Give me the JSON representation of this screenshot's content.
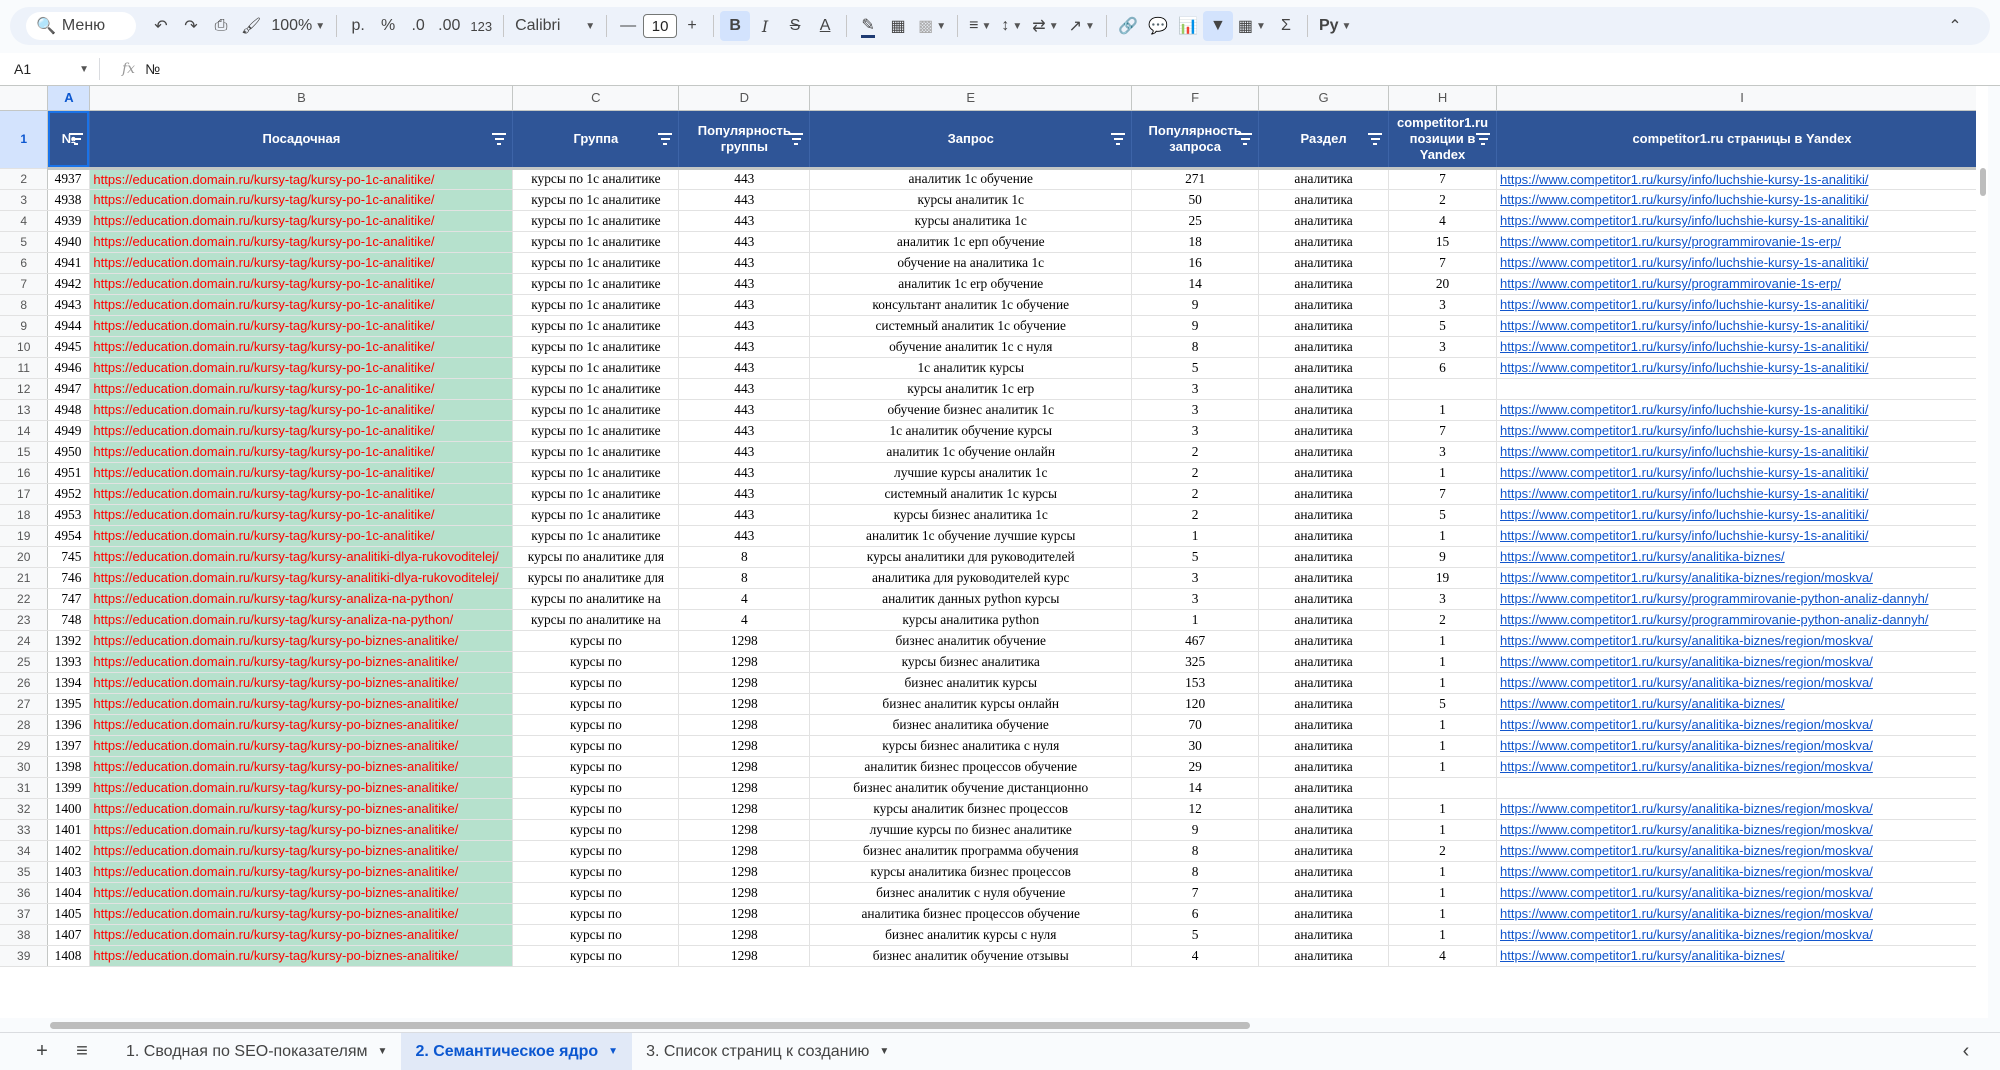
{
  "toolbar": {
    "menu_label": "Меню",
    "zoom": "100%",
    "currency": "р.",
    "percent": "%",
    "dec_decrease": ".0",
    "dec_increase": ".00",
    "number_format": "123",
    "font": "Calibri",
    "font_size": "10",
    "bold": "B",
    "italic": "I",
    "strike": "S",
    "text_color": "A",
    "sum": "Σ",
    "script": "Py"
  },
  "formula_bar": {
    "cell_ref": "A1",
    "fx": "fx",
    "content": "№"
  },
  "columns": [
    "A",
    "B",
    "C",
    "D",
    "E",
    "F",
    "G",
    "H",
    "I"
  ],
  "header_row": {
    "row_number": "1",
    "cells": [
      "№",
      "Посадочная",
      "Группа",
      "Популярность группы",
      "Запрос",
      "Популярность запроса",
      "Раздел",
      "competitor1.ru позиции в Yandex",
      "competitor1.ru страницы в Yandex"
    ]
  },
  "rows": [
    {
      "n": "2",
      "a": "4937",
      "b": "https://education.domain.ru/kursy-tag/kursy-po-1c-analitike/",
      "c": "курсы по 1с аналитике",
      "d": "443",
      "e": "аналитик 1с обучение",
      "f": "271",
      "g": "аналитика",
      "h": "7",
      "i": "https://www.competitor1.ru/kursy/info/luchshie-kursy-1s-analitiki/"
    },
    {
      "n": "3",
      "a": "4938",
      "b": "https://education.domain.ru/kursy-tag/kursy-po-1c-analitike/",
      "c": "курсы по 1с аналитике",
      "d": "443",
      "e": "курсы аналитик 1с",
      "f": "50",
      "g": "аналитика",
      "h": "2",
      "i": "https://www.competitor1.ru/kursy/info/luchshie-kursy-1s-analitiki/"
    },
    {
      "n": "4",
      "a": "4939",
      "b": "https://education.domain.ru/kursy-tag/kursy-po-1c-analitike/",
      "c": "курсы по 1с аналитике",
      "d": "443",
      "e": "курсы аналитика 1с",
      "f": "25",
      "g": "аналитика",
      "h": "4",
      "i": "https://www.competitor1.ru/kursy/info/luchshie-kursy-1s-analitiki/"
    },
    {
      "n": "5",
      "a": "4940",
      "b": "https://education.domain.ru/kursy-tag/kursy-po-1c-analitike/",
      "c": "курсы по 1с аналитике",
      "d": "443",
      "e": "аналитик 1с ерп обучение",
      "f": "18",
      "g": "аналитика",
      "h": "15",
      "i": "https://www.competitor1.ru/kursy/programmirovanie-1s-erp/"
    },
    {
      "n": "6",
      "a": "4941",
      "b": "https://education.domain.ru/kursy-tag/kursy-po-1c-analitike/",
      "c": "курсы по 1с аналитике",
      "d": "443",
      "e": "обучение на аналитика 1с",
      "f": "16",
      "g": "аналитика",
      "h": "7",
      "i": "https://www.competitor1.ru/kursy/info/luchshie-kursy-1s-analitiki/"
    },
    {
      "n": "7",
      "a": "4942",
      "b": "https://education.domain.ru/kursy-tag/kursy-po-1c-analitike/",
      "c": "курсы по 1с аналитике",
      "d": "443",
      "e": "аналитик 1с erp обучение",
      "f": "14",
      "g": "аналитика",
      "h": "20",
      "i": "https://www.competitor1.ru/kursy/programmirovanie-1s-erp/"
    },
    {
      "n": "8",
      "a": "4943",
      "b": "https://education.domain.ru/kursy-tag/kursy-po-1c-analitike/",
      "c": "курсы по 1с аналитике",
      "d": "443",
      "e": "консультант аналитик 1с обучение",
      "f": "9",
      "g": "аналитика",
      "h": "3",
      "i": "https://www.competitor1.ru/kursy/info/luchshie-kursy-1s-analitiki/"
    },
    {
      "n": "9",
      "a": "4944",
      "b": "https://education.domain.ru/kursy-tag/kursy-po-1c-analitike/",
      "c": "курсы по 1с аналитике",
      "d": "443",
      "e": "системный аналитик 1с обучение",
      "f": "9",
      "g": "аналитика",
      "h": "5",
      "i": "https://www.competitor1.ru/kursy/info/luchshie-kursy-1s-analitiki/"
    },
    {
      "n": "10",
      "a": "4945",
      "b": "https://education.domain.ru/kursy-tag/kursy-po-1c-analitike/",
      "c": "курсы по 1с аналитике",
      "d": "443",
      "e": "обучение аналитик 1с с нуля",
      "f": "8",
      "g": "аналитика",
      "h": "3",
      "i": "https://www.competitor1.ru/kursy/info/luchshie-kursy-1s-analitiki/"
    },
    {
      "n": "11",
      "a": "4946",
      "b": "https://education.domain.ru/kursy-tag/kursy-po-1c-analitike/",
      "c": "курсы по 1с аналитике",
      "d": "443",
      "e": "1с аналитик курсы",
      "f": "5",
      "g": "аналитика",
      "h": "6",
      "i": "https://www.competitor1.ru/kursy/info/luchshie-kursy-1s-analitiki/"
    },
    {
      "n": "12",
      "a": "4947",
      "b": "https://education.domain.ru/kursy-tag/kursy-po-1c-analitike/",
      "c": "курсы по 1с аналитике",
      "d": "443",
      "e": "курсы аналитик 1с erp",
      "f": "3",
      "g": "аналитика",
      "h": "",
      "i": ""
    },
    {
      "n": "13",
      "a": "4948",
      "b": "https://education.domain.ru/kursy-tag/kursy-po-1c-analitike/",
      "c": "курсы по 1с аналитике",
      "d": "443",
      "e": "обучение бизнес аналитик 1с",
      "f": "3",
      "g": "аналитика",
      "h": "1",
      "i": "https://www.competitor1.ru/kursy/info/luchshie-kursy-1s-analitiki/"
    },
    {
      "n": "14",
      "a": "4949",
      "b": "https://education.domain.ru/kursy-tag/kursy-po-1c-analitike/",
      "c": "курсы по 1с аналитике",
      "d": "443",
      "e": "1с аналитик обучение курсы",
      "f": "3",
      "g": "аналитика",
      "h": "7",
      "i": "https://www.competitor1.ru/kursy/info/luchshie-kursy-1s-analitiki/"
    },
    {
      "n": "15",
      "a": "4950",
      "b": "https://education.domain.ru/kursy-tag/kursy-po-1c-analitike/",
      "c": "курсы по 1с аналитике",
      "d": "443",
      "e": "аналитик 1с обучение онлайн",
      "f": "2",
      "g": "аналитика",
      "h": "3",
      "i": "https://www.competitor1.ru/kursy/info/luchshie-kursy-1s-analitiki/"
    },
    {
      "n": "16",
      "a": "4951",
      "b": "https://education.domain.ru/kursy-tag/kursy-po-1c-analitike/",
      "c": "курсы по 1с аналитике",
      "d": "443",
      "e": "лучшие курсы аналитик 1с",
      "f": "2",
      "g": "аналитика",
      "h": "1",
      "i": "https://www.competitor1.ru/kursy/info/luchshie-kursy-1s-analitiki/"
    },
    {
      "n": "17",
      "a": "4952",
      "b": "https://education.domain.ru/kursy-tag/kursy-po-1c-analitike/",
      "c": "курсы по 1с аналитике",
      "d": "443",
      "e": "системный аналитик 1с курсы",
      "f": "2",
      "g": "аналитика",
      "h": "7",
      "i": "https://www.competitor1.ru/kursy/info/luchshie-kursy-1s-analitiki/"
    },
    {
      "n": "18",
      "a": "4953",
      "b": "https://education.domain.ru/kursy-tag/kursy-po-1c-analitike/",
      "c": "курсы по 1с аналитике",
      "d": "443",
      "e": "курсы бизнес аналитика 1с",
      "f": "2",
      "g": "аналитика",
      "h": "5",
      "i": "https://www.competitor1.ru/kursy/info/luchshie-kursy-1s-analitiki/"
    },
    {
      "n": "19",
      "a": "4954",
      "b": "https://education.domain.ru/kursy-tag/kursy-po-1c-analitike/",
      "c": "курсы по 1с аналитике",
      "d": "443",
      "e": "аналитик 1с обучение лучшие курсы",
      "f": "1",
      "g": "аналитика",
      "h": "1",
      "i": "https://www.competitor1.ru/kursy/info/luchshie-kursy-1s-analitiki/"
    },
    {
      "n": "20",
      "a": "745",
      "b": "https://education.domain.ru/kursy-tag/kursy-analitiki-dlya-rukovoditelej/",
      "c": "курсы по аналитике для",
      "d": "8",
      "e": "курсы аналитики для руководителей",
      "f": "5",
      "g": "аналитика",
      "h": "9",
      "i": "https://www.competitor1.ru/kursy/analitika-biznes/"
    },
    {
      "n": "21",
      "a": "746",
      "b": "https://education.domain.ru/kursy-tag/kursy-analitiki-dlya-rukovoditelej/",
      "c": "курсы по аналитике для",
      "d": "8",
      "e": "аналитика для руководителей курс",
      "f": "3",
      "g": "аналитика",
      "h": "19",
      "i": "https://www.competitor1.ru/kursy/analitika-biznes/region/moskva/"
    },
    {
      "n": "22",
      "a": "747",
      "b": "https://education.domain.ru/kursy-tag/kursy-analiza-na-python/",
      "c": "курсы по аналитике на",
      "d": "4",
      "e": "аналитик данных python курсы",
      "f": "3",
      "g": "аналитика",
      "h": "3",
      "i": "https://www.competitor1.ru/kursy/programmirovanie-python-analiz-dannyh/"
    },
    {
      "n": "23",
      "a": "748",
      "b": "https://education.domain.ru/kursy-tag/kursy-analiza-na-python/",
      "c": "курсы по аналитике на",
      "d": "4",
      "e": "курсы аналитика python",
      "f": "1",
      "g": "аналитика",
      "h": "2",
      "i": "https://www.competitor1.ru/kursy/programmirovanie-python-analiz-dannyh/"
    },
    {
      "n": "24",
      "a": "1392",
      "b": "https://education.domain.ru/kursy-tag/kursy-po-biznes-analitike/",
      "c": "курсы по",
      "d": "1298",
      "e": "бизнес аналитик обучение",
      "f": "467",
      "g": "аналитика",
      "h": "1",
      "i": "https://www.competitor1.ru/kursy/analitika-biznes/region/moskva/"
    },
    {
      "n": "25",
      "a": "1393",
      "b": "https://education.domain.ru/kursy-tag/kursy-po-biznes-analitike/",
      "c": "курсы по",
      "d": "1298",
      "e": "курсы бизнес аналитика",
      "f": "325",
      "g": "аналитика",
      "h": "1",
      "i": "https://www.competitor1.ru/kursy/analitika-biznes/region/moskva/"
    },
    {
      "n": "26",
      "a": "1394",
      "b": "https://education.domain.ru/kursy-tag/kursy-po-biznes-analitike/",
      "c": "курсы по",
      "d": "1298",
      "e": "бизнес аналитик курсы",
      "f": "153",
      "g": "аналитика",
      "h": "1",
      "i": "https://www.competitor1.ru/kursy/analitika-biznes/region/moskva/"
    },
    {
      "n": "27",
      "a": "1395",
      "b": "https://education.domain.ru/kursy-tag/kursy-po-biznes-analitike/",
      "c": "курсы по",
      "d": "1298",
      "e": "бизнес аналитик курсы онлайн",
      "f": "120",
      "g": "аналитика",
      "h": "5",
      "i": "https://www.competitor1.ru/kursy/analitika-biznes/"
    },
    {
      "n": "28",
      "a": "1396",
      "b": "https://education.domain.ru/kursy-tag/kursy-po-biznes-analitike/",
      "c": "курсы по",
      "d": "1298",
      "e": "бизнес аналитика обучение",
      "f": "70",
      "g": "аналитика",
      "h": "1",
      "i": "https://www.competitor1.ru/kursy/analitika-biznes/region/moskva/"
    },
    {
      "n": "29",
      "a": "1397",
      "b": "https://education.domain.ru/kursy-tag/kursy-po-biznes-analitike/",
      "c": "курсы по",
      "d": "1298",
      "e": "курсы бизнес аналитика с нуля",
      "f": "30",
      "g": "аналитика",
      "h": "1",
      "i": "https://www.competitor1.ru/kursy/analitika-biznes/region/moskva/"
    },
    {
      "n": "30",
      "a": "1398",
      "b": "https://education.domain.ru/kursy-tag/kursy-po-biznes-analitike/",
      "c": "курсы по",
      "d": "1298",
      "e": "аналитик бизнес процессов обучение",
      "f": "29",
      "g": "аналитика",
      "h": "1",
      "i": "https://www.competitor1.ru/kursy/analitika-biznes/region/moskva/"
    },
    {
      "n": "31",
      "a": "1399",
      "b": "https://education.domain.ru/kursy-tag/kursy-po-biznes-analitike/",
      "c": "курсы по",
      "d": "1298",
      "e": "бизнес аналитик обучение дистанционно",
      "f": "14",
      "g": "аналитика",
      "h": "",
      "i": ""
    },
    {
      "n": "32",
      "a": "1400",
      "b": "https://education.domain.ru/kursy-tag/kursy-po-biznes-analitike/",
      "c": "курсы по",
      "d": "1298",
      "e": "курсы аналитик бизнес процессов",
      "f": "12",
      "g": "аналитика",
      "h": "1",
      "i": "https://www.competitor1.ru/kursy/analitika-biznes/region/moskva/"
    },
    {
      "n": "33",
      "a": "1401",
      "b": "https://education.domain.ru/kursy-tag/kursy-po-biznes-analitike/",
      "c": "курсы по",
      "d": "1298",
      "e": "лучшие курсы по бизнес аналитике",
      "f": "9",
      "g": "аналитика",
      "h": "1",
      "i": "https://www.competitor1.ru/kursy/analitika-biznes/region/moskva/"
    },
    {
      "n": "34",
      "a": "1402",
      "b": "https://education.domain.ru/kursy-tag/kursy-po-biznes-analitike/",
      "c": "курсы по",
      "d": "1298",
      "e": "бизнес аналитик программа обучения",
      "f": "8",
      "g": "аналитика",
      "h": "2",
      "i": "https://www.competitor1.ru/kursy/analitika-biznes/region/moskva/"
    },
    {
      "n": "35",
      "a": "1403",
      "b": "https://education.domain.ru/kursy-tag/kursy-po-biznes-analitike/",
      "c": "курсы по",
      "d": "1298",
      "e": "курсы аналитика бизнес процессов",
      "f": "8",
      "g": "аналитика",
      "h": "1",
      "i": "https://www.competitor1.ru/kursy/analitika-biznes/region/moskva/"
    },
    {
      "n": "36",
      "a": "1404",
      "b": "https://education.domain.ru/kursy-tag/kursy-po-biznes-analitike/",
      "c": "курсы по",
      "d": "1298",
      "e": "бизнес аналитик с нуля обучение",
      "f": "7",
      "g": "аналитика",
      "h": "1",
      "i": "https://www.competitor1.ru/kursy/analitika-biznes/region/moskva/"
    },
    {
      "n": "37",
      "a": "1405",
      "b": "https://education.domain.ru/kursy-tag/kursy-po-biznes-analitike/",
      "c": "курсы по",
      "d": "1298",
      "e": "аналитика бизнес процессов обучение",
      "f": "6",
      "g": "аналитика",
      "h": "1",
      "i": "https://www.competitor1.ru/kursy/analitika-biznes/region/moskva/"
    },
    {
      "n": "38",
      "a": "1407",
      "b": "https://education.domain.ru/kursy-tag/kursy-po-biznes-analitike/",
      "c": "курсы по",
      "d": "1298",
      "e": "бизнес аналитик курсы с нуля",
      "f": "5",
      "g": "аналитика",
      "h": "1",
      "i": "https://www.competitor1.ru/kursy/analitika-biznes/region/moskva/"
    },
    {
      "n": "39",
      "a": "1408",
      "b": "https://education.domain.ru/kursy-tag/kursy-po-biznes-analitike/",
      "c": "курсы по",
      "d": "1298",
      "e": "бизнес аналитик обучение отзывы",
      "f": "4",
      "g": "аналитика",
      "h": "4",
      "i": "https://www.competitor1.ru/kursy/analitika-biznes/"
    }
  ],
  "sheet_tabs": [
    {
      "label": "1. Сводная по SEO-показателям",
      "active": false
    },
    {
      "label": "2. Семантическое ядро",
      "active": true
    },
    {
      "label": "3. Список страниц к созданию",
      "active": false
    }
  ],
  "colors": {
    "header_bg": "#2f5597",
    "url_bg": "#b6e1cd",
    "url_text": "#ff0000",
    "link": "#1155cc",
    "selection": "#d3e3fd"
  }
}
